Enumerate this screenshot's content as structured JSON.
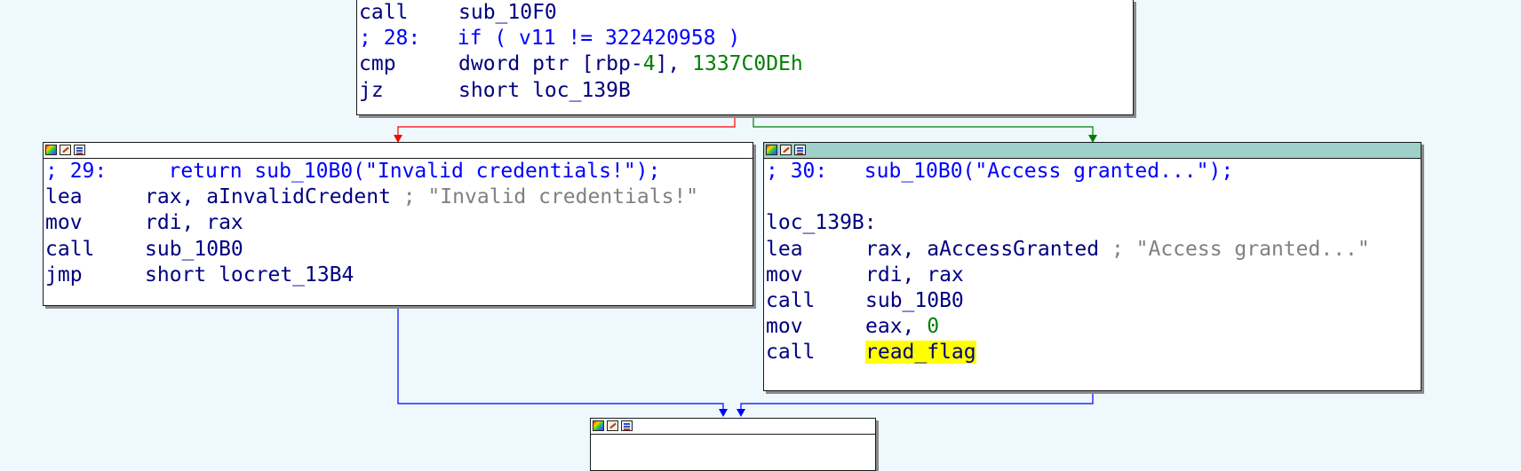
{
  "graph": {
    "colors": {
      "background": "#eef8fd",
      "instruction": "#000080",
      "number": "#008000",
      "comment": "#808080",
      "highlight": "#ffff00",
      "active_header": "#9fcfc9",
      "edge_false": "#ff0000",
      "edge_true": "#008000",
      "edge_jump": "#0000ff"
    },
    "blocks": {
      "top": {
        "lines": [
          {
            "mnem": "call",
            "ops": "sub_10F0"
          },
          {
            "text": "; 28:   if ( v11 != 322420958 )"
          },
          {
            "mnem": "cmp",
            "ops": "dword ptr [rbp-",
            "imm_inline": "4",
            "ops_tail": "], ",
            "imm": "1337C0DEh"
          },
          {
            "mnem": "jz",
            "ops": "short loc_139B"
          }
        ]
      },
      "fail": {
        "lines": [
          {
            "text": "; 29:     return sub_10B0(\"Invalid credentials!\");"
          },
          {
            "mnem": "lea",
            "ops": "rax, aInvalidCredent ",
            "comment": "; \"Invalid credentials!\""
          },
          {
            "mnem": "mov",
            "ops": "rdi, rax"
          },
          {
            "mnem": "call",
            "ops": "sub_10B0"
          },
          {
            "mnem": "jmp",
            "ops": "short locret_13B4"
          }
        ]
      },
      "success": {
        "lines": [
          {
            "text": "; 30:   sub_10B0(\"Access granted...\");"
          },
          {
            "blank": true
          },
          {
            "text": "loc_139B:"
          },
          {
            "mnem": "lea",
            "ops": "rax, aAccessGranted ",
            "comment": "; \"Access granted...\""
          },
          {
            "mnem": "mov",
            "ops": "rdi, rax"
          },
          {
            "mnem": "call",
            "ops": "sub_10B0"
          },
          {
            "mnem": "mov",
            "ops": "eax, ",
            "imm": "0"
          },
          {
            "mnem": "call",
            "ops": "",
            "highlight": "read_flag"
          }
        ]
      },
      "bottom": {
        "lines": []
      }
    },
    "header_icons": [
      "palette-icon",
      "edit-icon",
      "graph-overview-icon"
    ]
  }
}
